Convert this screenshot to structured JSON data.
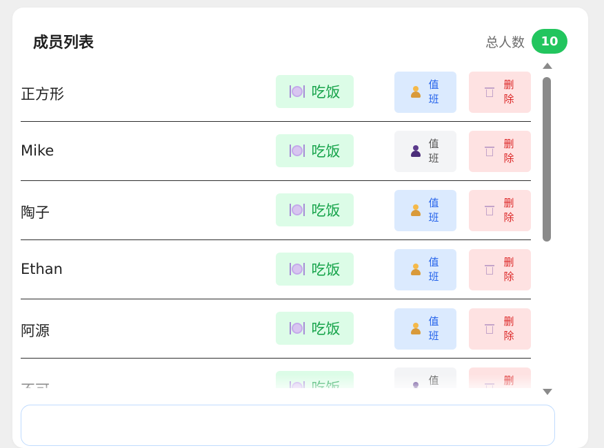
{
  "header": {
    "title": "成员列表",
    "count_label": "总人数",
    "count": "10"
  },
  "members": [
    {
      "name": "正方形",
      "eat_label": "吃饭",
      "duty_label": "值班",
      "duty_state": "on",
      "delete_label": "删除"
    },
    {
      "name": "Mike",
      "eat_label": "吃饭",
      "duty_label": "值班",
      "duty_state": "off",
      "delete_label": "删除"
    },
    {
      "name": "陶子",
      "eat_label": "吃饭",
      "duty_label": "值班",
      "duty_state": "on",
      "delete_label": "删除"
    },
    {
      "name": "Ethan",
      "eat_label": "吃饭",
      "duty_label": "值班",
      "duty_state": "on",
      "delete_label": "删除"
    },
    {
      "name": "阿源",
      "eat_label": "吃饭",
      "duty_label": "值班",
      "duty_state": "on",
      "delete_label": "删除"
    },
    {
      "name": "不可",
      "eat_label": "吃饭",
      "duty_label": "值班",
      "duty_state": "off",
      "delete_label": "删除"
    }
  ],
  "icons": {
    "eat": "plate-cutlery-icon",
    "duty_on": "worker-icon",
    "duty_off": "person-icon",
    "delete": "wastebasket-icon"
  },
  "colors": {
    "count_badge": "#22c55e",
    "eat_bg": "#dcfce7",
    "eat_text": "#16a34a",
    "duty_on_bg": "#dbeafe",
    "duty_on_text": "#2563eb",
    "duty_off_bg": "#f3f4f6",
    "delete_bg": "#fee2e2",
    "delete_text": "#dc2626"
  }
}
